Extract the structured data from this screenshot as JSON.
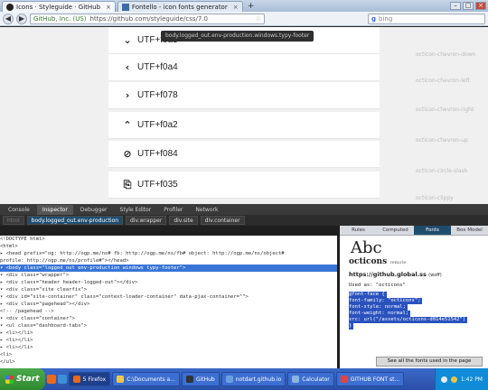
{
  "browser": {
    "tabs": [
      {
        "label": "Icons · Styleguide · GitHub",
        "active": true
      },
      {
        "label": "Fontello - icon fonts generator",
        "active": false
      }
    ],
    "new_tab": "+",
    "window_controls": {
      "minimize": "–",
      "maximize": "□",
      "close": "×"
    },
    "nav": {
      "back": "◀",
      "forward": "▶",
      "reload": "↻"
    },
    "url": {
      "ssl_label": "GitHub, Inc. (US)",
      "address": "https://github.com/styleguide/css/7.0"
    },
    "search": {
      "engine": "g",
      "query": "bing"
    }
  },
  "page": {
    "tooltip": "body.logged_out.env-production.windows.typy-footer",
    "rows": [
      {
        "glyph": "⌄",
        "code": "UTF+f0a3",
        "name": "octicon-chevron-down"
      },
      {
        "glyph": "‹",
        "code": "UTF+f0a4",
        "name": "octicon-chevron-left"
      },
      {
        "glyph": "›",
        "code": "UTF+f078",
        "name": "octicon-chevron-right"
      },
      {
        "glyph": "⌃",
        "code": "UTF+f0a2",
        "name": "octicon-chevron-up"
      },
      {
        "glyph": "⊘",
        "code": "UTF+f084",
        "name": "octicon-circle-slash"
      },
      {
        "glyph": "⎘",
        "code": "UTF+f035",
        "name": "octicon-clippy"
      }
    ]
  },
  "devtools": {
    "tabs": [
      "Console",
      "Inspector",
      "Debugger",
      "Style Editor",
      "Profiler",
      "Network"
    ],
    "active_tab": "Inspector",
    "breadcrumbs": [
      "html",
      "body.logged_out.env-production",
      "div.wrapper",
      "div.site",
      "div.container"
    ],
    "markup": [
      {
        "text": "<!DOCTYPE html>",
        "sel": false
      },
      {
        "text": "<html>",
        "sel": false
      },
      {
        "text": "▸ <head prefix=\"og: http://ogp.me/ns# fb: http://ogp.me/ns/fb# object: http://ogp.me/ns/object#",
        "sel": false
      },
      {
        "text": "    profile: http://ogp.me/ns/profile#\"></head>",
        "sel": false
      },
      {
        "text": "▾ <body class=\"logged_out env-production windows typy-footer\">",
        "sel": true
      },
      {
        "text": "  ▾ <div class=\"wrapper\">",
        "sel": false
      },
      {
        "text": "    ▸ <div class=\"header header-logged-out\"></div>",
        "sel": false
      },
      {
        "text": "    ▾ <div class=\"site clearfix\">",
        "sel": false
      },
      {
        "text": "      ▾ <div id=\"site-container\" class=\"context-loader-container\" data-pjax-container=\"\">",
        "sel": false
      },
      {
        "text": "        ▸ <div class=\"pagehead\"></div>",
        "sel": false
      },
      {
        "text": "          <!-- /pagehead -->",
        "sel": false
      },
      {
        "text": "        ▾ <div class=\"container\">",
        "sel": false
      },
      {
        "text": "          ▾ <ul class=\"dashboard-tabs\">",
        "sel": false
      },
      {
        "text": "            ▸ <li></li>",
        "sel": false
      },
      {
        "text": "            ▸ <li></li>",
        "sel": false
      },
      {
        "text": "            ▸ <li></li>",
        "sel": false
      },
      {
        "text": "              <li>",
        "sel": false
      },
      {
        "text": "              </ul>",
        "sel": false
      }
    ],
    "side_tabs": [
      "Rules",
      "Computed",
      "Fonts",
      "Box Model"
    ],
    "active_side_tab": "Fonts",
    "font": {
      "sample": "Abc",
      "name": "octicons",
      "source": "remote",
      "url": "https://github.global.ss",
      "format": "(woff)",
      "used_as": "Used as: \"octicons\"",
      "fontface": [
        "@font-face {",
        "  font-family: \"octicons\";",
        "  font-style: normal;",
        "  font-weight: normal;",
        "  src: url(\"/assets/octicons-d014e51542\")",
        "}"
      ],
      "see_all": "See all the fonts used in the page"
    }
  },
  "taskbar": {
    "start": "Start",
    "items": [
      {
        "label": "5 Firefox",
        "active": true,
        "color": "#e66a1f"
      },
      {
        "label": "C:\\Documents a...",
        "active": false,
        "color": "#f2c94c"
      },
      {
        "label": "GitHub",
        "active": false,
        "color": "#333333"
      },
      {
        "label": "notdart.github.io",
        "active": false,
        "color": "#6aa0e0"
      },
      {
        "label": "Calculator",
        "active": false,
        "color": "#8cb4e0"
      },
      {
        "label": "GITHUB FONT st...",
        "active": false,
        "color": "#d44"
      }
    ],
    "clock": "1:42 PM"
  }
}
